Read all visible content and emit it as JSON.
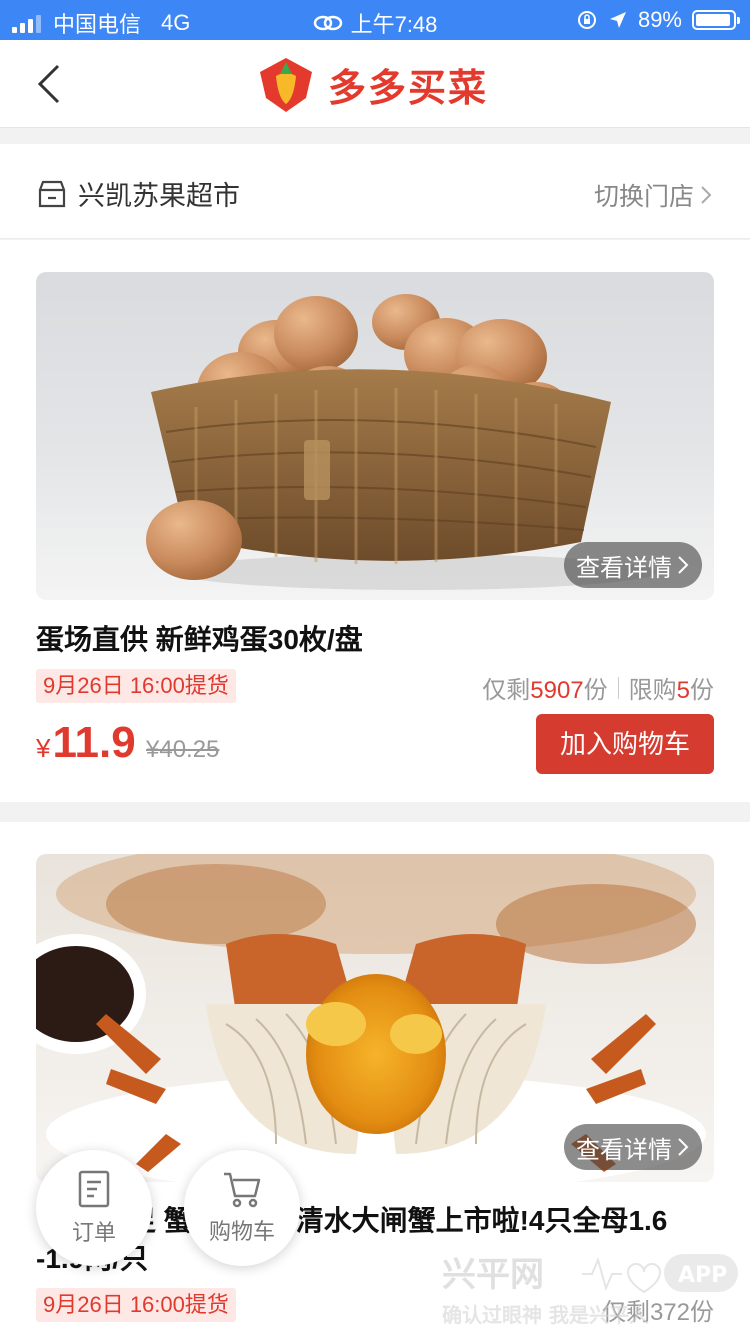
{
  "status_bar": {
    "carrier": "中国电信",
    "network": "4G",
    "time": "上午7:48",
    "battery_percent": "89%",
    "battery_level": 0.89
  },
  "nav": {
    "brand_name": "多多买菜",
    "back_icon": "chevron-left-icon"
  },
  "store": {
    "name": "兴凯苏果超市",
    "switch_label": "切换门店"
  },
  "products": [
    {
      "title": "蛋场直供 新鲜鸡蛋30枚/盘",
      "pickup": "9月26日 16:00提货",
      "remaining_prefix": "仅剩",
      "remaining_count": "5907",
      "remaining_unit": "份",
      "limit_prefix": "限购",
      "limit_count": "5",
      "limit_unit": "份",
      "currency": "¥",
      "price": "11.9",
      "original_price": "¥40.25",
      "add_cart_label": "加入购物车",
      "detail_label": "查看详情"
    },
    {
      "title_visible_a": "足 蟹",
      "title_visible_b": "清水大闸蟹上市啦!4只全母1.6",
      "title_line2": "-1.9两/只",
      "pickup": "9月26日 16:00提货",
      "remaining_text": "仅剩372份",
      "detail_label": "查看详情"
    }
  ],
  "floating": {
    "orders_label": "订单",
    "cart_label": "购物车"
  },
  "watermark": {
    "line1": "兴平网",
    "app": "APP",
    "line2": "确认过眼神 我是兴平人"
  },
  "colors": {
    "status_bar": "#3d86f5",
    "accent_red": "#d63b30",
    "price_red": "#e03a2f",
    "pickup_bg": "#fde8e6"
  }
}
